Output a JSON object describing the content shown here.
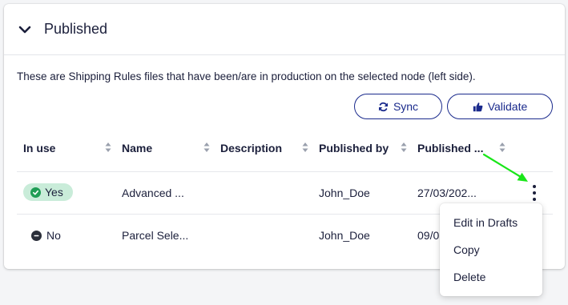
{
  "panel": {
    "title": "Published",
    "description": "These are Shipping Rules files that have been/are in production on the selected node (left side)."
  },
  "actions": {
    "sync_label": "Sync",
    "validate_label": "Validate"
  },
  "table": {
    "columns": [
      "In use",
      "Name",
      "Description",
      "Published by",
      "Published ..."
    ],
    "rows": [
      {
        "in_use": "Yes",
        "name": "Advanced ...",
        "description": "",
        "published_by": "John_Doe",
        "published": "27/03/202..."
      },
      {
        "in_use": "No",
        "name": "Parcel Sele...",
        "description": "",
        "published_by": "John_Doe",
        "published": "09/0"
      }
    ]
  },
  "context_menu": {
    "items": [
      "Edit in Drafts",
      "Copy",
      "Delete"
    ]
  },
  "colors": {
    "accent": "#1a2a8c",
    "badge_yes_bg": "#c9ecd9",
    "badge_yes_icon": "#1f9d55",
    "annotation_arrow": "#19e619"
  },
  "icons": {
    "panel_toggle": "chevron-down-icon",
    "sync": "sync-icon",
    "validate": "thumbs-up-icon",
    "row_actions": "more-vertical-icon"
  }
}
